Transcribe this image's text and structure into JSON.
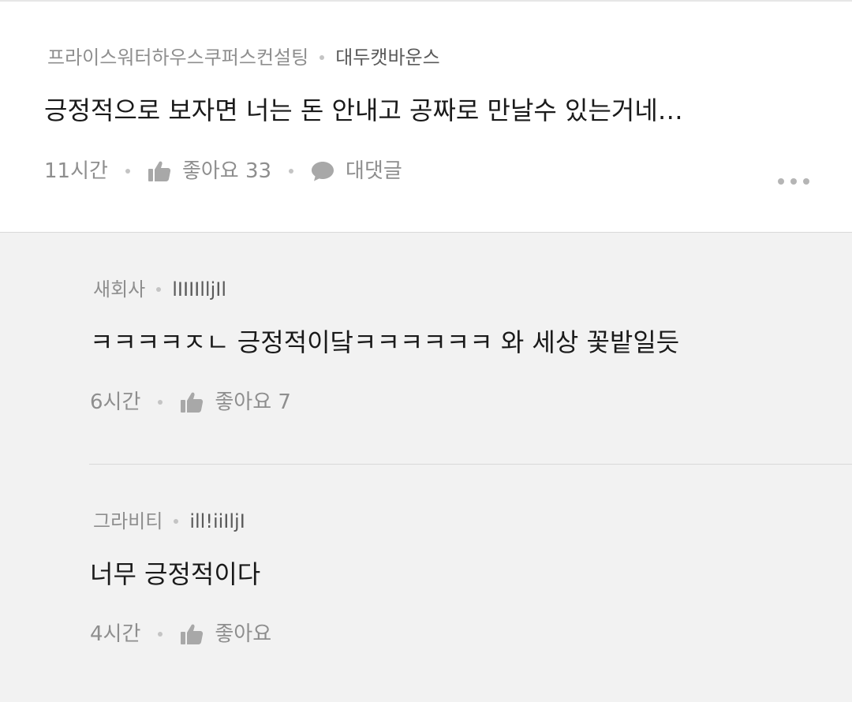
{
  "comments": [
    {
      "author": "프라이스워터하우스쿠퍼스컨설팅",
      "handle": "대두캣바운스",
      "text": "긍정적으로 보자면 너는 돈 안내고 공짜로 만날수 있는거네…",
      "time": "11시간",
      "like_label": "좋아요 33",
      "reply_label": "대댓글"
    }
  ],
  "replies": [
    {
      "author": "새회사",
      "handle": "lIIIIlljIl",
      "text": "ㅋㅋㅋㅋㅈㄴ 긍정적이닼ㅋㅋㅋㅋㅋㅋ 와 세상 꽃밭일듯",
      "time": "6시간",
      "like_label": "좋아요 7"
    },
    {
      "author": "그라비티",
      "handle": "ill!iiIljI",
      "text": "너무 긍정적이다",
      "time": "4시간",
      "like_label": "좋아요"
    }
  ],
  "icons": {
    "like": "thumbs-up-icon",
    "reply": "speech-bubble-icon",
    "more": "more-dots-icon"
  },
  "colors": {
    "background": "#f2f2f2",
    "card": "#ffffff",
    "text_primary": "#1a1a1a",
    "text_secondary": "#8e8e8e",
    "icon": "#a8a8a8"
  }
}
